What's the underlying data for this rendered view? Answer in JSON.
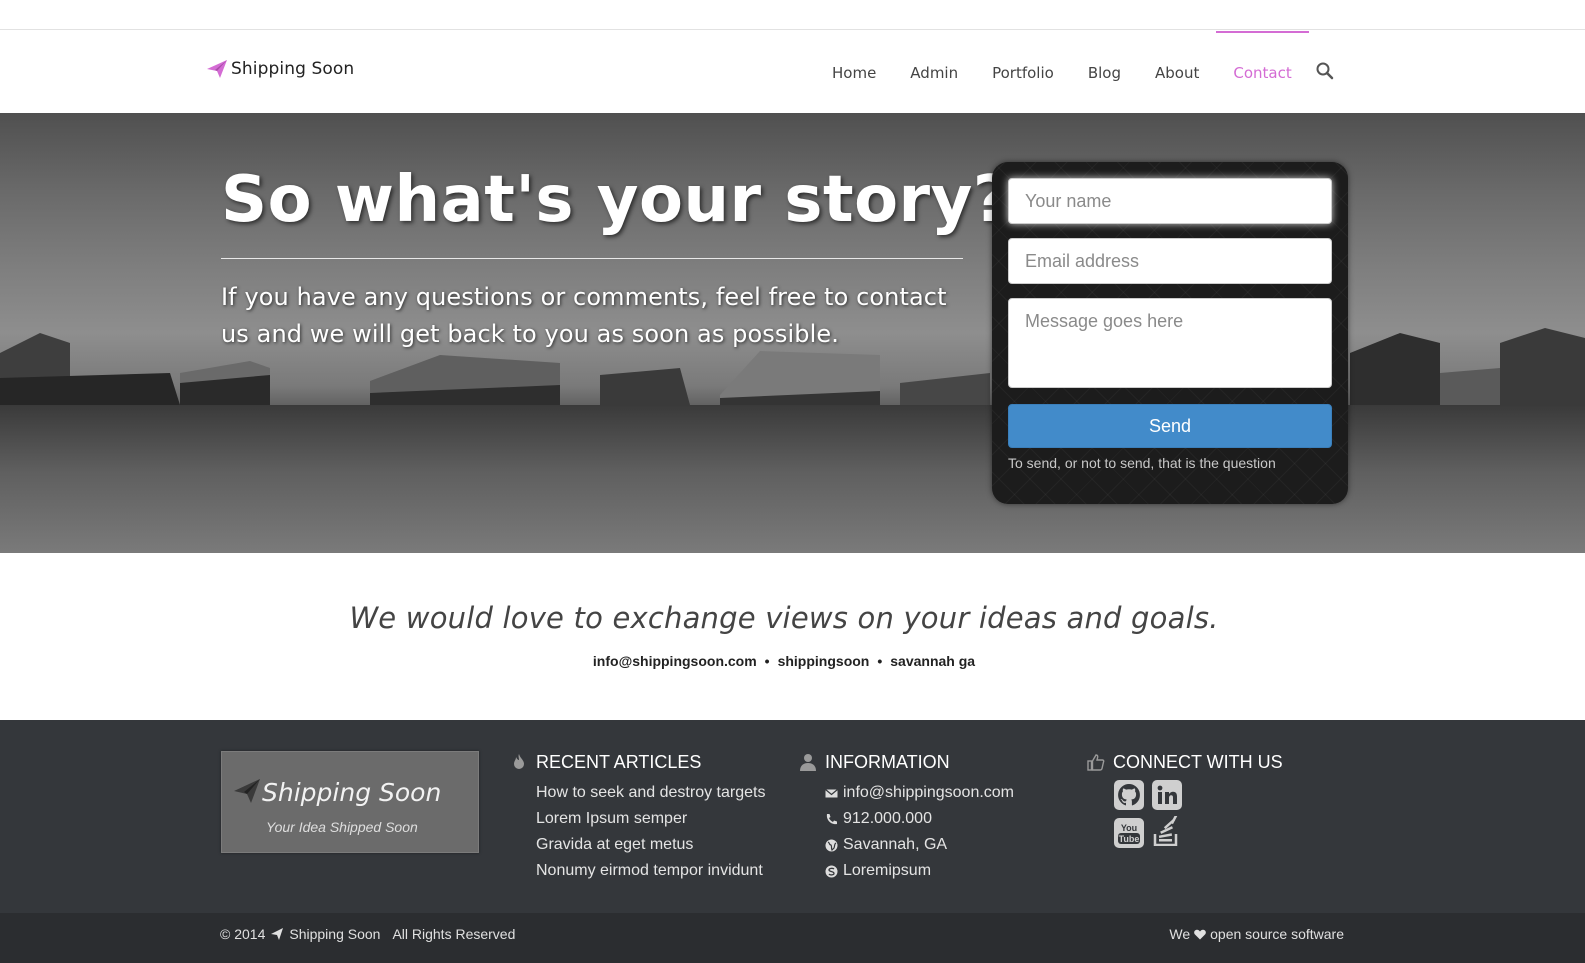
{
  "colors": {
    "accent": "#d46cd4",
    "send_button": "#428bca",
    "footer_bg": "#34373b",
    "bottombar_bg": "#2b2d30"
  },
  "header": {
    "brand": "Shipping Soon",
    "brand_icon": "paper-plane-icon",
    "nav": [
      {
        "label": "Home",
        "active": false
      },
      {
        "label": "Admin",
        "active": false
      },
      {
        "label": "Portfolio",
        "active": false
      },
      {
        "label": "Blog",
        "active": false
      },
      {
        "label": "About",
        "active": false
      },
      {
        "label": "Contact",
        "active": true
      }
    ],
    "search_icon": "search-icon"
  },
  "hero": {
    "title": "So what's your story?",
    "subtitle": "If you have any questions or comments, feel free to contact us and we will get back to you as soon as possible."
  },
  "contact_form": {
    "name_placeholder": "Your name",
    "email_placeholder": "Email address",
    "message_placeholder": "Message goes here",
    "send_label": "Send",
    "note": "To send, or not to send, that is the question"
  },
  "views": {
    "tagline": "We would love to exchange views on your ideas and goals.",
    "email": "info@shippingsoon.com",
    "handle": "shippingsoon",
    "location": "savannah ga",
    "separator": "•"
  },
  "footer": {
    "brand_name": "Shipping Soon",
    "brand_tagline": "Your Idea Shipped Soon",
    "recent_articles": {
      "heading": "RECENT ARTICLES",
      "icon": "fire-icon",
      "items": [
        "How to seek and destroy targets",
        "Lorem Ipsum semper",
        "Gravida at eget metus",
        "Nonumy eirmod tempor invidunt"
      ]
    },
    "information": {
      "heading": "INFORMATION",
      "icon": "user-icon",
      "items": [
        {
          "icon": "envelope-icon",
          "text": "info@shippingsoon.com"
        },
        {
          "icon": "phone-icon",
          "text": "912.000.000"
        },
        {
          "icon": "globe-icon",
          "text": "Savannah, GA"
        },
        {
          "icon": "skype-icon",
          "text": "Loremipsum"
        }
      ]
    },
    "connect": {
      "heading": "CONNECT WITH US",
      "icon": "thumbs-up-icon",
      "social": [
        "github-icon",
        "linkedin-icon",
        "youtube-icon",
        "stackoverflow-icon"
      ]
    }
  },
  "bottombar": {
    "copyright": "© 2014",
    "brand": "Shipping Soon",
    "rights": "All Rights Reserved",
    "love_prefix": "We",
    "love_suffix": "open source software"
  }
}
